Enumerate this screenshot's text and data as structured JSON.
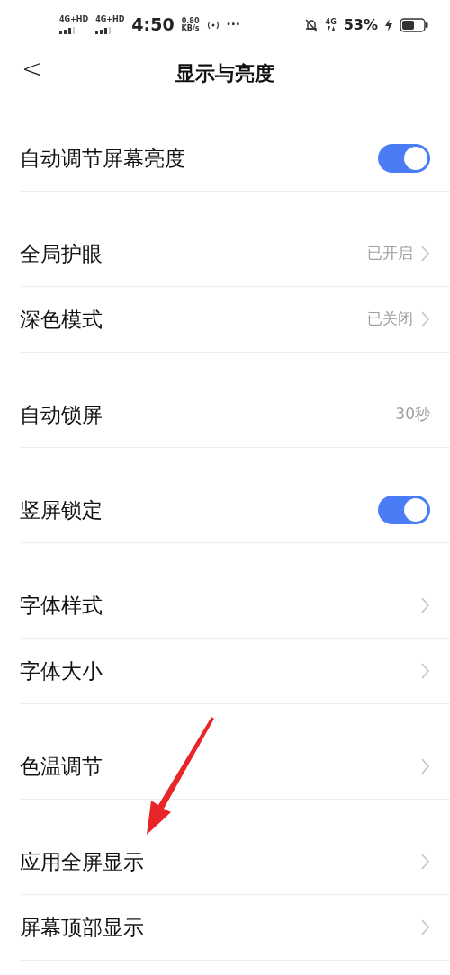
{
  "status_bar": {
    "networks": [
      "4G+HD",
      "4G+HD"
    ],
    "time": "4:50",
    "speed": {
      "value": "0.80",
      "unit": "KB/s"
    },
    "more": "•••",
    "data_network": "4G",
    "battery": "53%"
  },
  "header": {
    "back": "<",
    "title": "显示与亮度"
  },
  "groups": [
    {
      "items": [
        {
          "kind": "toggle",
          "label": "自动调节屏幕亮度",
          "on": true
        }
      ]
    },
    {
      "items": [
        {
          "kind": "link",
          "label": "全局护眼",
          "value": "已开启"
        },
        {
          "kind": "link",
          "label": "深色模式",
          "value": "已关闭"
        }
      ]
    },
    {
      "items": [
        {
          "kind": "value",
          "label": "自动锁屏",
          "value": "30秒"
        }
      ]
    },
    {
      "items": [
        {
          "kind": "toggle",
          "label": "竖屏锁定",
          "on": true
        }
      ]
    },
    {
      "items": [
        {
          "kind": "link",
          "label": "字体样式"
        },
        {
          "kind": "link",
          "label": "字体大小"
        }
      ]
    },
    {
      "items": [
        {
          "kind": "link",
          "label": "色温调节"
        }
      ]
    },
    {
      "items": [
        {
          "kind": "link",
          "label": "应用全屏显示"
        },
        {
          "kind": "link",
          "label": "屏幕顶部显示"
        }
      ]
    }
  ]
}
